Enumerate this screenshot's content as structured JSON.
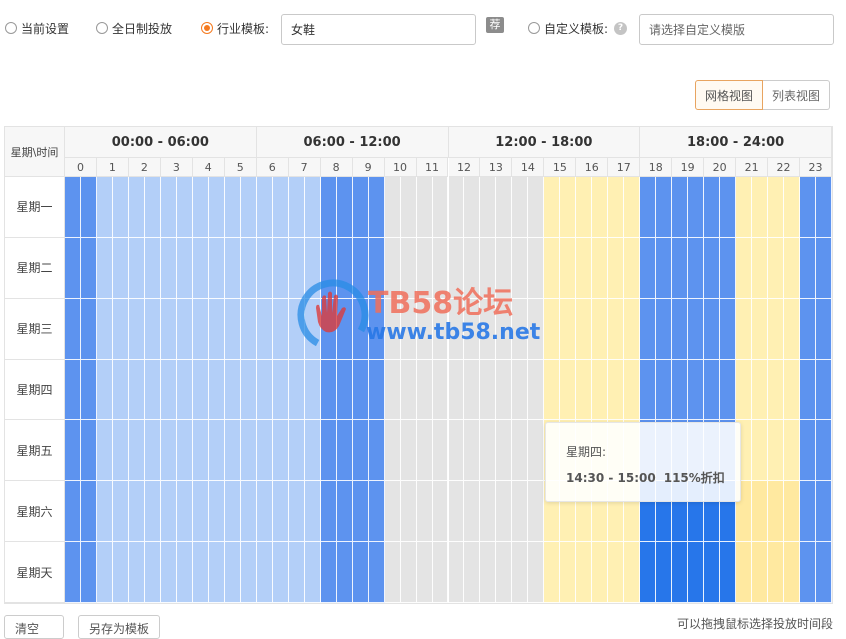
{
  "options": {
    "current_settings": "当前设置",
    "all_day": "全日制投放",
    "industry_template": "行业模板:",
    "industry_value": "女鞋",
    "recommend_badge": "荐",
    "custom_template": "自定义模板:",
    "custom_placeholder": "请选择自定义模版",
    "selected": "industry_template"
  },
  "view_toggle": {
    "grid": "网格视图",
    "list": "列表视图",
    "active": "grid"
  },
  "grid": {
    "corner": "星期\\时间",
    "periods": [
      "00:00 - 06:00",
      "06:00 - 12:00",
      "12:00 - 18:00",
      "18:00 - 24:00"
    ],
    "hours": [
      "0",
      "1",
      "2",
      "3",
      "4",
      "5",
      "6",
      "7",
      "8",
      "9",
      "10",
      "11",
      "12",
      "13",
      "14",
      "15",
      "16",
      "17",
      "18",
      "19",
      "20",
      "21",
      "22",
      "23"
    ],
    "days": [
      "星期一",
      "星期二",
      "星期三",
      "星期四",
      "星期五",
      "星期六",
      "星期天"
    ],
    "legend_colors": {
      "light_blue": "#b3cff8",
      "medium_blue": "#5d93ef",
      "dark_blue": "#2776ea",
      "grey": "#e4e4e4",
      "light_yellow": "#fff0b3",
      "yellow": "#ffe9a0"
    },
    "half_hour_levels": [
      [
        "medium_blue",
        "medium_blue",
        "light_blue",
        "light_blue",
        "light_blue",
        "light_blue",
        "light_blue",
        "light_blue",
        "light_blue",
        "light_blue",
        "light_blue",
        "light_blue",
        "light_blue",
        "light_blue",
        "light_blue",
        "light_blue",
        "medium_blue",
        "medium_blue",
        "medium_blue",
        "medium_blue",
        "grey",
        "grey",
        "grey",
        "grey",
        "grey",
        "grey",
        "grey",
        "grey",
        "grey",
        "grey",
        "light_yellow",
        "light_yellow",
        "light_yellow",
        "light_yellow",
        "light_yellow",
        "light_yellow",
        "medium_blue",
        "medium_blue",
        "medium_blue",
        "medium_blue",
        "medium_blue",
        "medium_blue",
        "light_yellow",
        "light_yellow",
        "light_yellow",
        "light_yellow",
        "medium_blue",
        "medium_blue"
      ],
      [
        "medium_blue",
        "medium_blue",
        "light_blue",
        "light_blue",
        "light_blue",
        "light_blue",
        "light_blue",
        "light_blue",
        "light_blue",
        "light_blue",
        "light_blue",
        "light_blue",
        "light_blue",
        "light_blue",
        "light_blue",
        "light_blue",
        "medium_blue",
        "medium_blue",
        "medium_blue",
        "medium_blue",
        "grey",
        "grey",
        "grey",
        "grey",
        "grey",
        "grey",
        "grey",
        "grey",
        "grey",
        "grey",
        "light_yellow",
        "light_yellow",
        "light_yellow",
        "light_yellow",
        "light_yellow",
        "light_yellow",
        "medium_blue",
        "medium_blue",
        "medium_blue",
        "medium_blue",
        "medium_blue",
        "medium_blue",
        "light_yellow",
        "light_yellow",
        "light_yellow",
        "light_yellow",
        "medium_blue",
        "medium_blue"
      ],
      [
        "medium_blue",
        "medium_blue",
        "light_blue",
        "light_blue",
        "light_blue",
        "light_blue",
        "light_blue",
        "light_blue",
        "light_blue",
        "light_blue",
        "light_blue",
        "light_blue",
        "light_blue",
        "light_blue",
        "light_blue",
        "light_blue",
        "medium_blue",
        "medium_blue",
        "medium_blue",
        "medium_blue",
        "grey",
        "grey",
        "grey",
        "grey",
        "grey",
        "grey",
        "grey",
        "grey",
        "grey",
        "grey",
        "light_yellow",
        "light_yellow",
        "light_yellow",
        "light_yellow",
        "light_yellow",
        "light_yellow",
        "medium_blue",
        "medium_blue",
        "medium_blue",
        "medium_blue",
        "medium_blue",
        "medium_blue",
        "light_yellow",
        "light_yellow",
        "light_yellow",
        "light_yellow",
        "medium_blue",
        "medium_blue"
      ],
      [
        "medium_blue",
        "medium_blue",
        "light_blue",
        "light_blue",
        "light_blue",
        "light_blue",
        "light_blue",
        "light_blue",
        "light_blue",
        "light_blue",
        "light_blue",
        "light_blue",
        "light_blue",
        "light_blue",
        "light_blue",
        "light_blue",
        "medium_blue",
        "medium_blue",
        "medium_blue",
        "medium_blue",
        "grey",
        "grey",
        "grey",
        "grey",
        "grey",
        "grey",
        "grey",
        "grey",
        "grey",
        "grey",
        "light_yellow",
        "light_yellow",
        "light_yellow",
        "light_yellow",
        "light_yellow",
        "light_yellow",
        "medium_blue",
        "medium_blue",
        "medium_blue",
        "medium_blue",
        "medium_blue",
        "medium_blue",
        "light_yellow",
        "light_yellow",
        "light_yellow",
        "light_yellow",
        "medium_blue",
        "medium_blue"
      ],
      [
        "medium_blue",
        "medium_blue",
        "light_blue",
        "light_blue",
        "light_blue",
        "light_blue",
        "light_blue",
        "light_blue",
        "light_blue",
        "light_blue",
        "light_blue",
        "light_blue",
        "light_blue",
        "light_blue",
        "light_blue",
        "light_blue",
        "medium_blue",
        "medium_blue",
        "medium_blue",
        "medium_blue",
        "grey",
        "grey",
        "grey",
        "grey",
        "grey",
        "grey",
        "grey",
        "grey",
        "grey",
        "grey",
        "light_yellow",
        "light_yellow",
        "light_yellow",
        "light_yellow",
        "light_yellow",
        "light_yellow",
        "medium_blue",
        "medium_blue",
        "medium_blue",
        "medium_blue",
        "medium_blue",
        "medium_blue",
        "light_yellow",
        "light_yellow",
        "light_yellow",
        "light_yellow",
        "medium_blue",
        "medium_blue"
      ],
      [
        "medium_blue",
        "medium_blue",
        "light_blue",
        "light_blue",
        "light_blue",
        "light_blue",
        "light_blue",
        "light_blue",
        "light_blue",
        "light_blue",
        "light_blue",
        "light_blue",
        "light_blue",
        "light_blue",
        "light_blue",
        "light_blue",
        "medium_blue",
        "medium_blue",
        "medium_blue",
        "medium_blue",
        "grey",
        "grey",
        "grey",
        "grey",
        "grey",
        "grey",
        "grey",
        "grey",
        "grey",
        "grey",
        "light_yellow",
        "light_yellow",
        "light_yellow",
        "light_yellow",
        "light_yellow",
        "light_yellow",
        "dark_blue",
        "dark_blue",
        "dark_blue",
        "dark_blue",
        "dark_blue",
        "dark_blue",
        "yellow",
        "yellow",
        "yellow",
        "yellow",
        "medium_blue",
        "medium_blue"
      ],
      [
        "medium_blue",
        "medium_blue",
        "light_blue",
        "light_blue",
        "light_blue",
        "light_blue",
        "light_blue",
        "light_blue",
        "light_blue",
        "light_blue",
        "light_blue",
        "light_blue",
        "light_blue",
        "light_blue",
        "light_blue",
        "light_blue",
        "medium_blue",
        "medium_blue",
        "medium_blue",
        "medium_blue",
        "grey",
        "grey",
        "grey",
        "grey",
        "grey",
        "grey",
        "grey",
        "grey",
        "grey",
        "grey",
        "light_yellow",
        "light_yellow",
        "light_yellow",
        "light_yellow",
        "light_yellow",
        "light_yellow",
        "dark_blue",
        "dark_blue",
        "dark_blue",
        "dark_blue",
        "dark_blue",
        "dark_blue",
        "yellow",
        "yellow",
        "yellow",
        "yellow",
        "medium_blue",
        "medium_blue"
      ]
    ]
  },
  "tooltip": {
    "day": "星期四:",
    "time": "14:30 - 15:00",
    "discount": "115%折扣"
  },
  "watermark": {
    "line1": "TB58论坛",
    "line2": "www.tb58.net"
  },
  "footer": {
    "clear": "清空",
    "save_template": "另存为模板",
    "hint": "可以拖拽鼠标选择投放时间段"
  }
}
